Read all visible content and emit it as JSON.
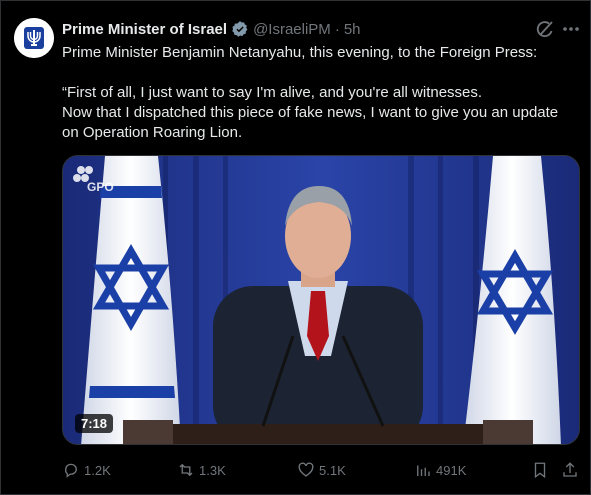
{
  "author": {
    "name": "Prime Minister of Israel",
    "handle": "@IsraeliPM",
    "separator": "·",
    "time": "5h"
  },
  "post": {
    "line1": "Prime Minister Benjamin Netanyahu, this evening, to the Foreign Press:",
    "quote": "“First of all, I just want to say I'm alive, and you're all witnesses.\nNow that I dispatched this piece of fake news, I want to give you an update on Operation Roaring Lion."
  },
  "media": {
    "watermark": "GPO",
    "duration": "7:18"
  },
  "actions": {
    "replies": "1.2K",
    "reposts": "1.3K",
    "likes": "5.1K",
    "views": "491K"
  },
  "colors": {
    "background": "#000000",
    "muted": "#71767b",
    "verified": "#829aab",
    "flag_blue": "#1a3fa6"
  },
  "icons": [
    "verified-badge-icon",
    "grok-icon",
    "more-icon",
    "reply-icon",
    "repost-icon",
    "like-icon",
    "views-icon",
    "bookmark-icon",
    "share-icon"
  ]
}
